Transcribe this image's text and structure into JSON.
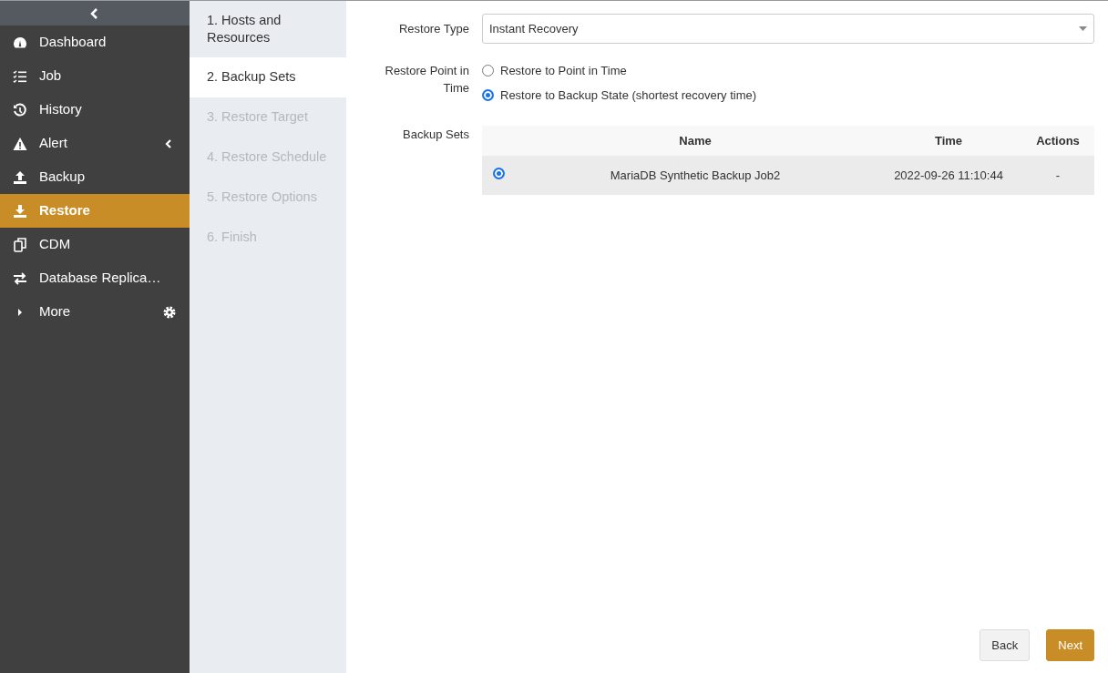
{
  "sidebar": {
    "items": [
      {
        "label": "Dashboard",
        "kind": "link",
        "selected": false
      },
      {
        "label": "Job",
        "kind": "link",
        "selected": false
      },
      {
        "label": "History",
        "kind": "link",
        "selected": false
      },
      {
        "label": "Alert",
        "kind": "submenu",
        "selected": false
      },
      {
        "label": "Backup",
        "kind": "link",
        "selected": false
      },
      {
        "label": "Restore",
        "kind": "link",
        "selected": true
      },
      {
        "label": "CDM",
        "kind": "link",
        "selected": false
      },
      {
        "label": "Database Replica…",
        "kind": "link",
        "selected": false
      },
      {
        "label": "More",
        "kind": "more",
        "selected": false
      }
    ]
  },
  "steps": [
    {
      "label": "1. Hosts and Resources",
      "selected": false,
      "disabled": false
    },
    {
      "label": "2. Backup Sets",
      "selected": true,
      "disabled": false
    },
    {
      "label": "3. Restore Target",
      "selected": false,
      "disabled": true
    },
    {
      "label": "4. Restore Schedule",
      "selected": false,
      "disabled": true
    },
    {
      "label": "5. Restore Options",
      "selected": false,
      "disabled": true
    },
    {
      "label": "6. Finish",
      "selected": false,
      "disabled": true
    }
  ],
  "form": {
    "restore_type": {
      "label": "Restore Type",
      "value": "Instant Recovery"
    },
    "restore_point": {
      "label": "Restore Point in Time",
      "options": [
        {
          "label": "Restore to Point in Time",
          "selected": false
        },
        {
          "label": "Restore to Backup State (shortest recovery time)",
          "selected": true
        }
      ]
    },
    "backup_sets": {
      "label": "Backup Sets",
      "columns": [
        "Name",
        "Time",
        "Actions"
      ],
      "rows": [
        {
          "name": "MariaDB Synthetic Backup Job2",
          "time": "2022-09-26 11:10:44",
          "actions": "-",
          "selected": true
        }
      ]
    }
  },
  "buttons": [
    {
      "label": "Back",
      "kind": "secondary"
    },
    {
      "label": "Next",
      "kind": "primary"
    }
  ]
}
